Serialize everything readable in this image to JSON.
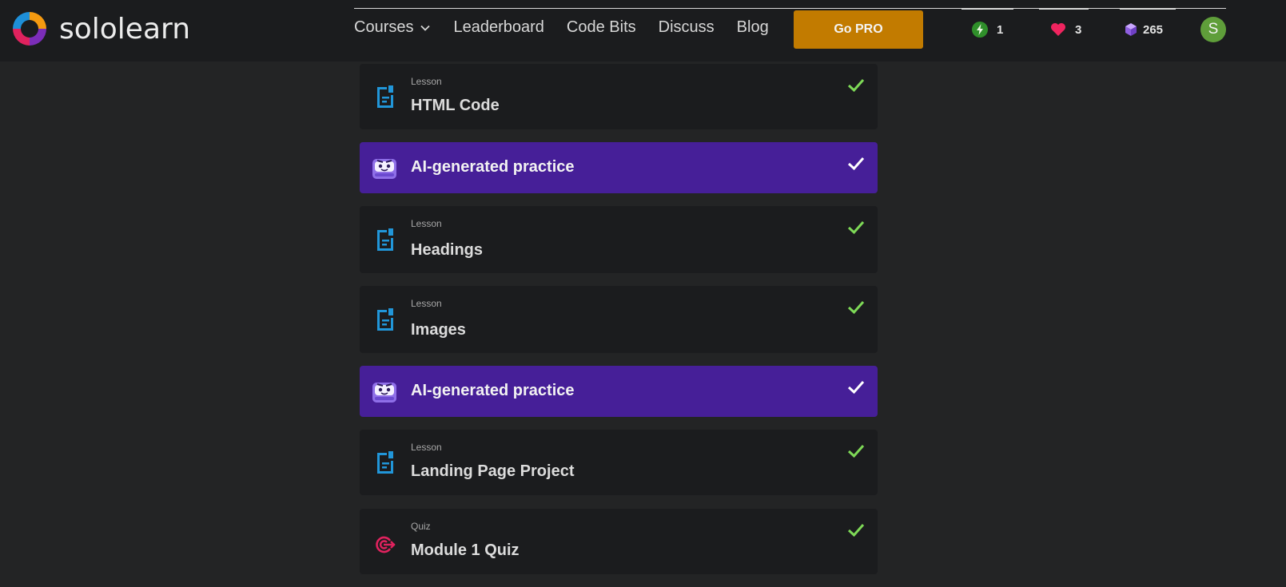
{
  "app": {
    "name": "sololearn"
  },
  "nav": {
    "courses": "Courses",
    "leaderboard": "Leaderboard",
    "code_bits": "Code Bits",
    "discuss": "Discuss",
    "blog": "Blog",
    "go_pro": "Go PRO"
  },
  "stats": {
    "streak": "1",
    "hearts": "3",
    "bits": "265"
  },
  "user": {
    "avatar_letter": "S"
  },
  "colors": {
    "background": "#232425",
    "topbar": "#1b1c1e",
    "card": "#1b1c1e",
    "ai_card": "#461f98",
    "go_pro": "#c27b00",
    "check_green": "#7ed957",
    "lesson_icon": "#2196d9",
    "quiz_icon": "#e0225e",
    "avatar": "#5f9e3a"
  },
  "items": [
    {
      "type": "Lesson",
      "title": "HTML Code",
      "icon": "document-icon",
      "completed": true
    },
    {
      "type": "",
      "title": "AI-generated practice",
      "icon": "robot-icon",
      "completed": true
    },
    {
      "type": "Lesson",
      "title": "Headings",
      "icon": "document-icon",
      "completed": true
    },
    {
      "type": "Lesson",
      "title": "Images",
      "icon": "document-icon",
      "completed": true
    },
    {
      "type": "",
      "title": "AI-generated practice",
      "icon": "robot-icon",
      "completed": true
    },
    {
      "type": "Lesson",
      "title": "Landing Page Project",
      "icon": "document-icon",
      "completed": true
    },
    {
      "type": "Quiz",
      "title": "Module 1 Quiz",
      "icon": "target-icon",
      "completed": true
    }
  ]
}
